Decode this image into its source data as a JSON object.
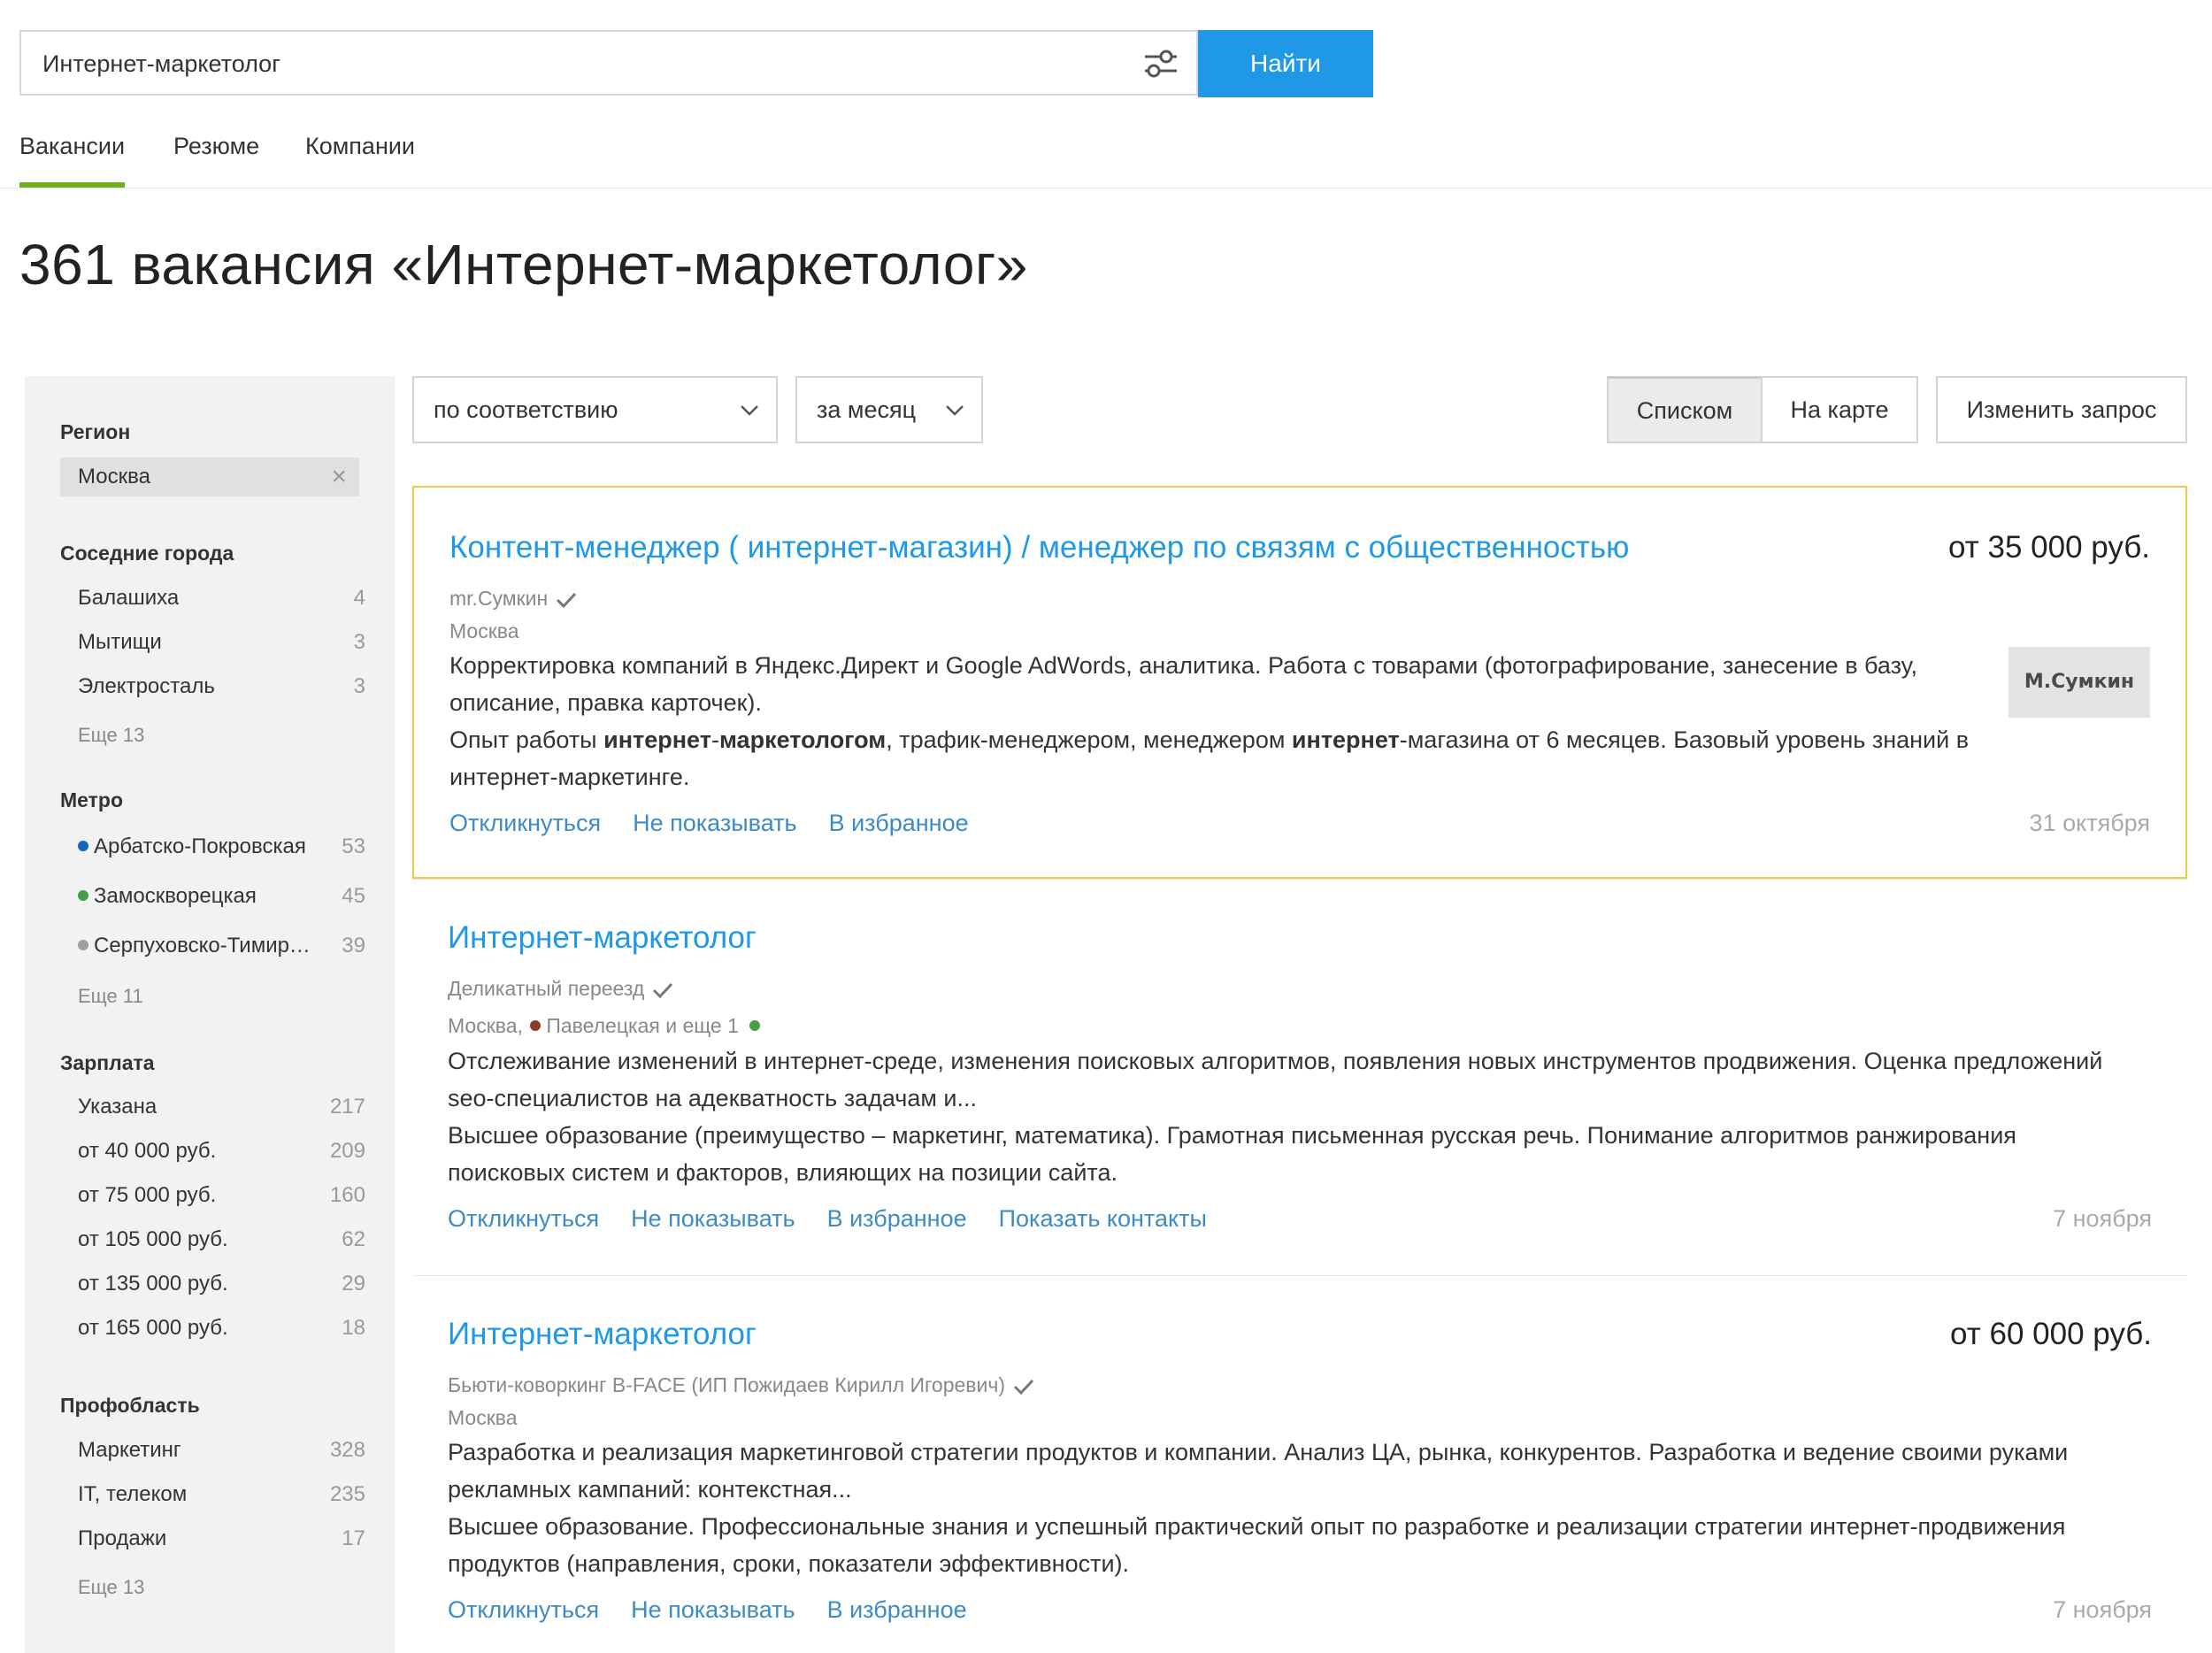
{
  "search": {
    "value": "Интернет-маркетолог",
    "button": "Найти"
  },
  "tabs": [
    {
      "label": "Вакансии",
      "active": true
    },
    {
      "label": "Резюме",
      "active": false
    },
    {
      "label": "Компании",
      "active": false
    }
  ],
  "page_title": "361 вакансия «Интернет-маркетолог»",
  "sidebar": {
    "region": {
      "heading": "Регион",
      "value": "Москва"
    },
    "nearby": {
      "heading": "Соседние города",
      "items": [
        {
          "label": "Балашиха",
          "count": "4"
        },
        {
          "label": "Мытищи",
          "count": "3"
        },
        {
          "label": "Электросталь",
          "count": "3"
        }
      ],
      "more": "Еще 13"
    },
    "metro": {
      "heading": "Метро",
      "items": [
        {
          "label": "Арбатско-Покровская",
          "count": "53",
          "color": "#1565c0"
        },
        {
          "label": "Замоскворецкая",
          "count": "45",
          "color": "#43a047"
        },
        {
          "label": "Серпуховско-Тимирязевская",
          "count": "39",
          "color": "#9e9e9e"
        }
      ],
      "more": "Еще 11"
    },
    "salary": {
      "heading": "Зарплата",
      "items": [
        {
          "label": "Указана",
          "count": "217"
        },
        {
          "label": "от 40 000 руб.",
          "count": "209"
        },
        {
          "label": "от 75 000 руб.",
          "count": "160"
        },
        {
          "label": "от 105 000 руб.",
          "count": "62"
        },
        {
          "label": "от 135 000 руб.",
          "count": "29"
        },
        {
          "label": "от 165 000 руб.",
          "count": "18"
        }
      ]
    },
    "prof": {
      "heading": "Профобласть",
      "items": [
        {
          "label": "Маркетинг",
          "count": "328"
        },
        {
          "label": "IT, телеком",
          "count": "235"
        },
        {
          "label": "Продажи",
          "count": "17"
        }
      ],
      "more": "Еще 13"
    }
  },
  "controls": {
    "sort": "по соответствию",
    "period": "за месяц",
    "view_list": "Списком",
    "view_map": "На карте",
    "edit_query": "Изменить запрос"
  },
  "vacancies": [
    {
      "title": "Контент-менеджер ( интернет-магазин) / менеджер по связям с общественностью",
      "salary": "от 35 000 руб.",
      "company": "mr.Сумкин",
      "location": "Москва",
      "logo_text": "M.Сумкин",
      "desc1": "Корректировка компаний в Яндекс.Директ и Google AdWords, аналитика. Работа с товарами (фотографирование, занесение в базу, описание, правка карточек).",
      "desc2_parts": [
        "Опыт работы ",
        "интернет",
        "-",
        "маркетологом",
        ", трафик-менеджером, менеджером ",
        "интернет",
        "-магазина от 6 месяцев. Базовый уровень знаний в интернет-маркетинге."
      ],
      "actions": [
        "Откликнуться",
        "Не показывать",
        "В избранное"
      ],
      "date": "31 октября"
    },
    {
      "title": "Интернет-маркетолог",
      "salary": "",
      "company": "Деликатный переезд",
      "location": "Москва,",
      "metro": "Павелецкая и еще 1",
      "metro_colors": [
        "#8d3b2b",
        "#43a047"
      ],
      "desc1": "Отслеживание изменений в интернет-среде, изменения поисковых алгоритмов, появления новых инструментов продвижения. Оценка предложений seo-специалистов на адекватность задачам и...",
      "desc2": "Высшее образование (преимущество – маркетинг, математика). Грамотная письменная русская речь. Понимание алгоритмов ранжирования поисковых систем и факторов, влияющих на позиции сайта.",
      "actions": [
        "Откликнуться",
        "Не показывать",
        "В избранное",
        "Показать контакты"
      ],
      "date": "7 ноября"
    },
    {
      "title": "Интернет-маркетолог",
      "salary": "от 60 000 руб.",
      "company": "Бьюти-коворкинг B-FACE (ИП Пожидаев Кирилл Игоревич)",
      "location": "Москва",
      "desc1": "Разработка и реализация маркетинговой стратегии продуктов и компании. Анализ ЦА, рынка, конкурентов. Разработка и ведение своими руками рекламных кампаний: контекстная...",
      "desc2": "Высшее образование. Профессиональные знания и успешный практический опыт по разработке и реализации стратегии интернет-продвижения продуктов (направления, сроки, показатели эффективности).",
      "actions": [
        "Откликнуться",
        "Не показывать",
        "В избранное"
      ],
      "date": "7 ноября"
    }
  ],
  "colors": {
    "accent": "#1e98e7",
    "link": "#3c8bc7",
    "tab_underline": "#6fb021",
    "highlight_border": "#f2c94c"
  }
}
